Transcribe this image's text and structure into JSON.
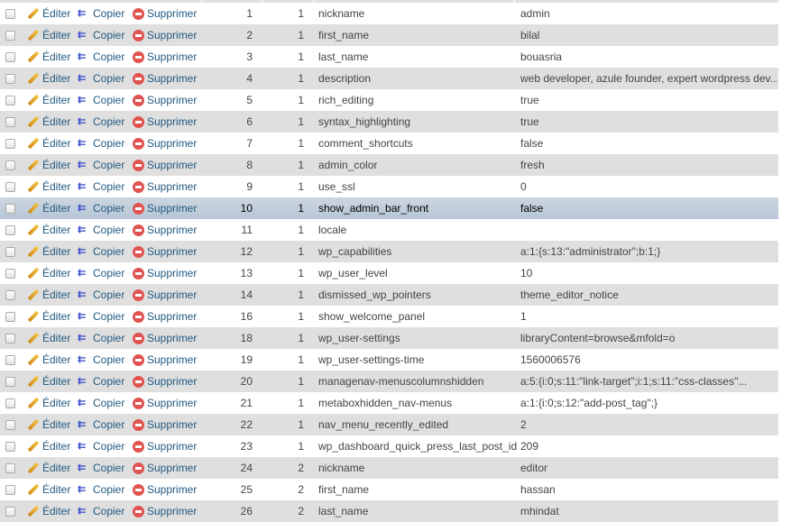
{
  "actions": {
    "edit": "Éditer",
    "copy": "Copier",
    "delete": "Supprimer"
  },
  "icons": {
    "edit": "pencil-icon",
    "copy": "copy-icon",
    "delete": "delete-icon"
  },
  "colors": {
    "link": "#235a81",
    "even_row": "#dfdfdf",
    "marked_row": "#c4cfdb"
  },
  "marked_row_index": 9,
  "rows": [
    {
      "umeta_id": "1",
      "user_id": "1",
      "meta_key": "nickname",
      "meta_value": "admin"
    },
    {
      "umeta_id": "2",
      "user_id": "1",
      "meta_key": "first_name",
      "meta_value": "bilal"
    },
    {
      "umeta_id": "3",
      "user_id": "1",
      "meta_key": "last_name",
      "meta_value": "bouasria"
    },
    {
      "umeta_id": "4",
      "user_id": "1",
      "meta_key": "description",
      "meta_value": "web developer, azule founder, expert wordpress dev..."
    },
    {
      "umeta_id": "5",
      "user_id": "1",
      "meta_key": "rich_editing",
      "meta_value": "true"
    },
    {
      "umeta_id": "6",
      "user_id": "1",
      "meta_key": "syntax_highlighting",
      "meta_value": "true"
    },
    {
      "umeta_id": "7",
      "user_id": "1",
      "meta_key": "comment_shortcuts",
      "meta_value": "false"
    },
    {
      "umeta_id": "8",
      "user_id": "1",
      "meta_key": "admin_color",
      "meta_value": "fresh"
    },
    {
      "umeta_id": "9",
      "user_id": "1",
      "meta_key": "use_ssl",
      "meta_value": "0"
    },
    {
      "umeta_id": "10",
      "user_id": "1",
      "meta_key": "show_admin_bar_front",
      "meta_value": "false"
    },
    {
      "umeta_id": "11",
      "user_id": "1",
      "meta_key": "locale",
      "meta_value": ""
    },
    {
      "umeta_id": "12",
      "user_id": "1",
      "meta_key": "wp_capabilities",
      "meta_value": "a:1:{s:13:\"administrator\";b:1;}"
    },
    {
      "umeta_id": "13",
      "user_id": "1",
      "meta_key": "wp_user_level",
      "meta_value": "10"
    },
    {
      "umeta_id": "14",
      "user_id": "1",
      "meta_key": "dismissed_wp_pointers",
      "meta_value": "theme_editor_notice"
    },
    {
      "umeta_id": "16",
      "user_id": "1",
      "meta_key": "show_welcome_panel",
      "meta_value": "1"
    },
    {
      "umeta_id": "18",
      "user_id": "1",
      "meta_key": "wp_user-settings",
      "meta_value": "libraryContent=browse&mfold=o"
    },
    {
      "umeta_id": "19",
      "user_id": "1",
      "meta_key": "wp_user-settings-time",
      "meta_value": "1560006576"
    },
    {
      "umeta_id": "20",
      "user_id": "1",
      "meta_key": "managenav-menuscolumnshidden",
      "meta_value": "a:5:{i:0;s:11:\"link-target\";i:1;s:11:\"css-classes\"..."
    },
    {
      "umeta_id": "21",
      "user_id": "1",
      "meta_key": "metaboxhidden_nav-menus",
      "meta_value": "a:1:{i:0;s:12:\"add-post_tag\";}"
    },
    {
      "umeta_id": "22",
      "user_id": "1",
      "meta_key": "nav_menu_recently_edited",
      "meta_value": "2"
    },
    {
      "umeta_id": "23",
      "user_id": "1",
      "meta_key": "wp_dashboard_quick_press_last_post_id",
      "meta_value": "209"
    },
    {
      "umeta_id": "24",
      "user_id": "2",
      "meta_key": "nickname",
      "meta_value": "editor"
    },
    {
      "umeta_id": "25",
      "user_id": "2",
      "meta_key": "first_name",
      "meta_value": "hassan"
    },
    {
      "umeta_id": "26",
      "user_id": "2",
      "meta_key": "last_name",
      "meta_value": "mhindat"
    }
  ]
}
